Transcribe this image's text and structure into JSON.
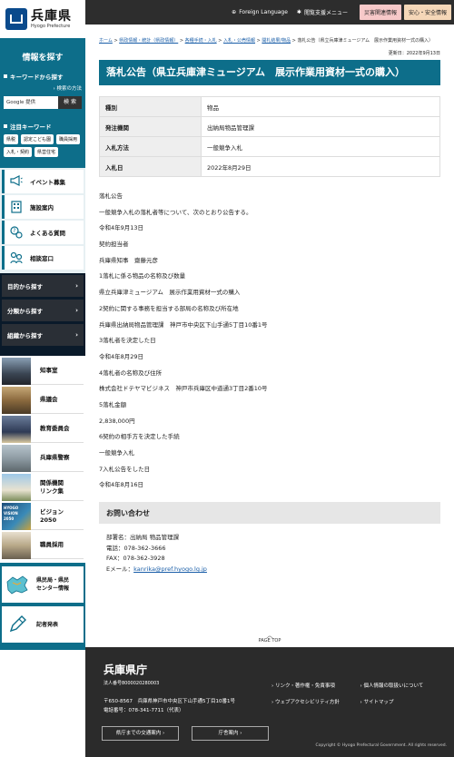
{
  "header": {
    "logo_jp": "兵庫県",
    "logo_en": "Hyogo Prefecture",
    "foreign_language": "Foreign Language",
    "accessibility_menu": "閲覧支援メニュー",
    "disaster_button": "災害関連情報",
    "safety_button": "安心・安全情報"
  },
  "sidebar": {
    "search_title": "情報を探す",
    "keyword_heading": "キーワードから探す",
    "search_howto": "検索の方法",
    "search_placeholder": "Google 提供",
    "search_button": "検 索",
    "notable_heading": "注目キーワード",
    "keywords": [
      "県税",
      "認定こども園",
      "職員採用",
      "入札・契約",
      "県営住宅"
    ],
    "menu": [
      {
        "label": "イベント募集",
        "icon": "megaphone-icon"
      },
      {
        "label": "施設案内",
        "icon": "building-icon"
      },
      {
        "label": "よくある質問",
        "icon": "question-icon"
      },
      {
        "label": "相談窓口",
        "icon": "consultation-icon"
      }
    ],
    "dark_menu": [
      "目的から探す",
      "分類から探す",
      "組織から探す"
    ],
    "photo_menu": [
      {
        "label": "知事室"
      },
      {
        "label": "県議会"
      },
      {
        "label": "教育委員会"
      },
      {
        "label": "兵庫県警察"
      },
      {
        "label": "関係機関\nリンク集"
      },
      {
        "label": "ビジョン\n2050"
      },
      {
        "label": "職員採用"
      }
    ],
    "vision_thumb_text": "HYOGO VISION 2050",
    "bureau_center": "県民局・県民\nセンター情報",
    "press": "記者発表"
  },
  "breadcrumb": {
    "items": [
      "ホーム",
      "県政情報・統計（県政情報）",
      "各種手続・入札",
      "入札・公売情報",
      "開札結果/物品"
    ],
    "current": "落札公告（県立兵庫津ミュージアム　展示作業用資材一式の購入）"
  },
  "page": {
    "updated": "更新日：2022年9月13日",
    "title": "落札公告（県立兵庫津ミュージアム　展示作業用資材一式の購入）",
    "info_rows": [
      {
        "label": "種別",
        "value": "物品"
      },
      {
        "label": "発注機関",
        "value": "出納局物品管理課"
      },
      {
        "label": "入札方法",
        "value": "一般競争入札"
      },
      {
        "label": "入札日",
        "value": "2022年8月29日"
      }
    ],
    "body_lines": [
      "落札公告",
      "一般競争入札の落札者等について、次のとおり公告する。",
      "令和4年9月13日",
      "契約担当者",
      "兵庫県知事　齋藤元彦",
      "1落札に係る物品の名称及び数量",
      "県立兵庫津ミュージアム　展示作業用資材一式の購入",
      "2契約に関する事務を担当する部局の名称及び所在地",
      "兵庫県出納局物品管理課　神戸市中央区下山手通5丁目10番1号",
      "3落札者を決定した日",
      "令和4年8月29日",
      "4落札者の名称及び住所",
      "株式会社ドテヤマビジネス　神戸市兵庫区中道通3丁目2番10号",
      "5落札金額",
      "2,838,000円",
      "6契約の相手方を決定した手続",
      "一般競争入札",
      "7入札公告をした日",
      "令和4年8月16日"
    ],
    "contact_heading": "お問い合わせ",
    "contact_dept": "部署名：出納局 物品管理課",
    "contact_tel": "電話：078-362-3666",
    "contact_fax": "FAX：078-362-3928",
    "contact_email_label": "Eメール：",
    "contact_email": "kanrika@pref.hyogo.lg.jp"
  },
  "pagetop": "PAGE TOP",
  "footer": {
    "name": "兵庫県庁",
    "corp_number": "法人番号8000020280003",
    "address": "〒650-8567　兵庫県神戸市中央区下山手通5丁目10番1号",
    "phone": "電話番号：078-341-7711（代表）",
    "links": [
      "リンク・著作権・免責事項",
      "個人情報の取扱いについて",
      "ウェブアクセシビリティ方針",
      "サイトマップ"
    ],
    "access_button": "県庁までの交通案内",
    "guide_button": "庁舎案内",
    "copyright": "Copyright © Hyogo Prefectural Government. All rights reserved."
  }
}
